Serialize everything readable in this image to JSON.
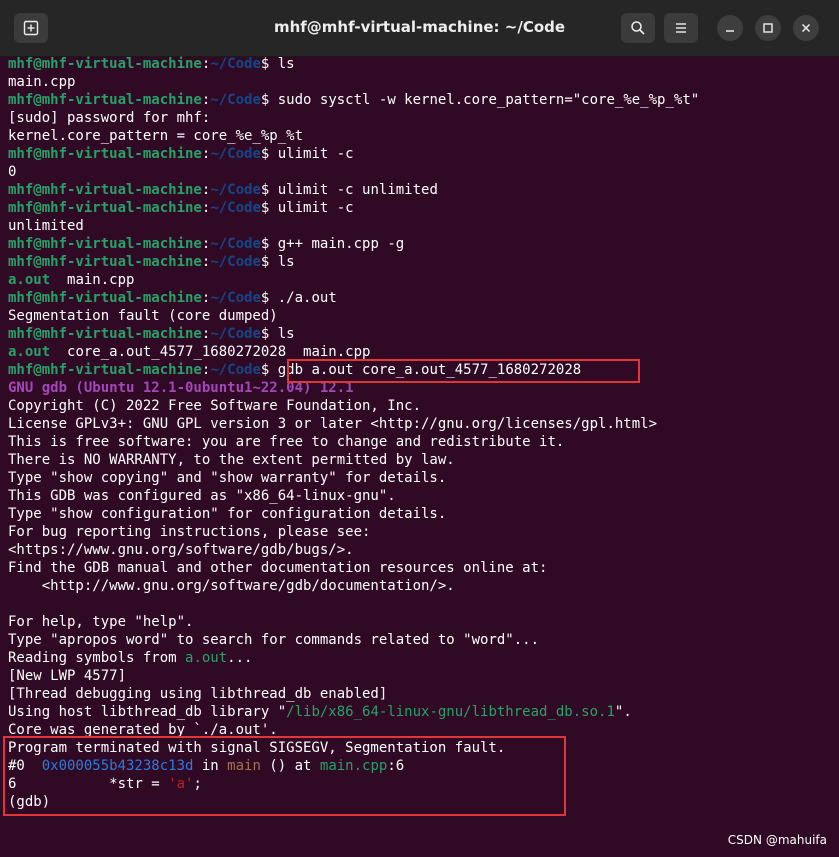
{
  "window": {
    "title": "mhf@mhf-virtual-machine: ~/Code",
    "icons": {
      "new_tab": "new-tab-icon",
      "search": "search-icon",
      "menu": "hamburger-menu-icon",
      "minimize": "minimize-icon",
      "maximize": "maximize-icon",
      "close": "close-icon"
    }
  },
  "prompt": {
    "user_host": "mhf@mhf-virtual-machine",
    "colon": ":",
    "path": "~/Code",
    "sign": "$ "
  },
  "terminal": {
    "cmd_ls_1": "ls",
    "out_main_cpp": "main.cpp",
    "cmd_sysctl": "sudo sysctl -w kernel.core_pattern=\"core_%e_%p_%t\"",
    "out_sudo": "[sudo] password for mhf:",
    "out_core_pattern": "kernel.core_pattern = core_%e_%p_%t",
    "cmd_ulimit_c_1": "ulimit -c",
    "out_zero": "0",
    "cmd_ulimit_unlimited": "ulimit -c unlimited",
    "cmd_ulimit_c_2": "ulimit -c",
    "out_unlimited": "unlimited",
    "cmd_gpp": "g++ main.cpp -g",
    "cmd_ls_2": "ls",
    "out_ls2_aout": "a.out",
    "out_ls2_main": "  main.cpp",
    "cmd_run": "./a.out",
    "out_segfault": "Segmentation fault (core dumped)",
    "cmd_ls_3": "ls",
    "out_ls3_aout": "a.out",
    "out_ls3_rest": "  core_a.out_4577_1680272028  main.cpp",
    "cmd_gdb": "gdb a.out core_a.out_4577_1680272028",
    "gdb_version": "GNU gdb (Ubuntu 12.1-0ubuntu1~22.04) 12.1",
    "gdb_lines": [
      "Copyright (C) 2022 Free Software Foundation, Inc.",
      "License GPLv3+: GNU GPL version 3 or later <http://gnu.org/licenses/gpl.html>",
      "This is free software: you are free to change and redistribute it.",
      "There is NO WARRANTY, to the extent permitted by law.",
      "Type \"show copying\" and \"show warranty\" for details.",
      "This GDB was configured as \"x86_64-linux-gnu\".",
      "Type \"show configuration\" for configuration details.",
      "For bug reporting instructions, please see:",
      "<https://www.gnu.org/software/gdb/bugs/>.",
      "Find the GDB manual and other documentation resources online at:",
      "    <http://www.gnu.org/software/gdb/documentation/>.",
      "",
      "For help, type \"help\".",
      "Type \"apropos word\" to search for commands related to \"word\"..."
    ],
    "reading_prefix": "Reading symbols from ",
    "reading_file": "a.out",
    "reading_suffix": "...",
    "new_lwp": "[New LWP 4577]",
    "thread_debug": "[Thread debugging using libthread_db enabled]",
    "host_lib_prefix": "Using host libthread_db library \"",
    "host_lib_path": "/lib/x86_64-linux-gnu/libthread_db.so.1",
    "host_lib_suffix": "\".",
    "core_generated": "Core was generated by `./a.out'.",
    "terminated": "Program terminated with signal SIGSEGV, Segmentation fault.",
    "frame_num": "#0  ",
    "frame_addr": "0x000055b43238c13d",
    "frame_in": " in ",
    "frame_func": "main",
    "frame_at": " () at ",
    "frame_file": "main.cpp",
    "frame_line": ":6",
    "src_line_no": "6",
    "src_indent": "           ",
    "src_code_a": "*str = ",
    "src_code_b": "'a'",
    "src_code_c": ";",
    "gdb_prompt": "(gdb)"
  },
  "watermark": "CSDN @mahuifa",
  "colors": {
    "background": "#300a24",
    "user_green": "#26a269",
    "path_blue": "#12488b",
    "gdb_magenta": "#a347ba",
    "highlight_red": "#e2353a"
  }
}
